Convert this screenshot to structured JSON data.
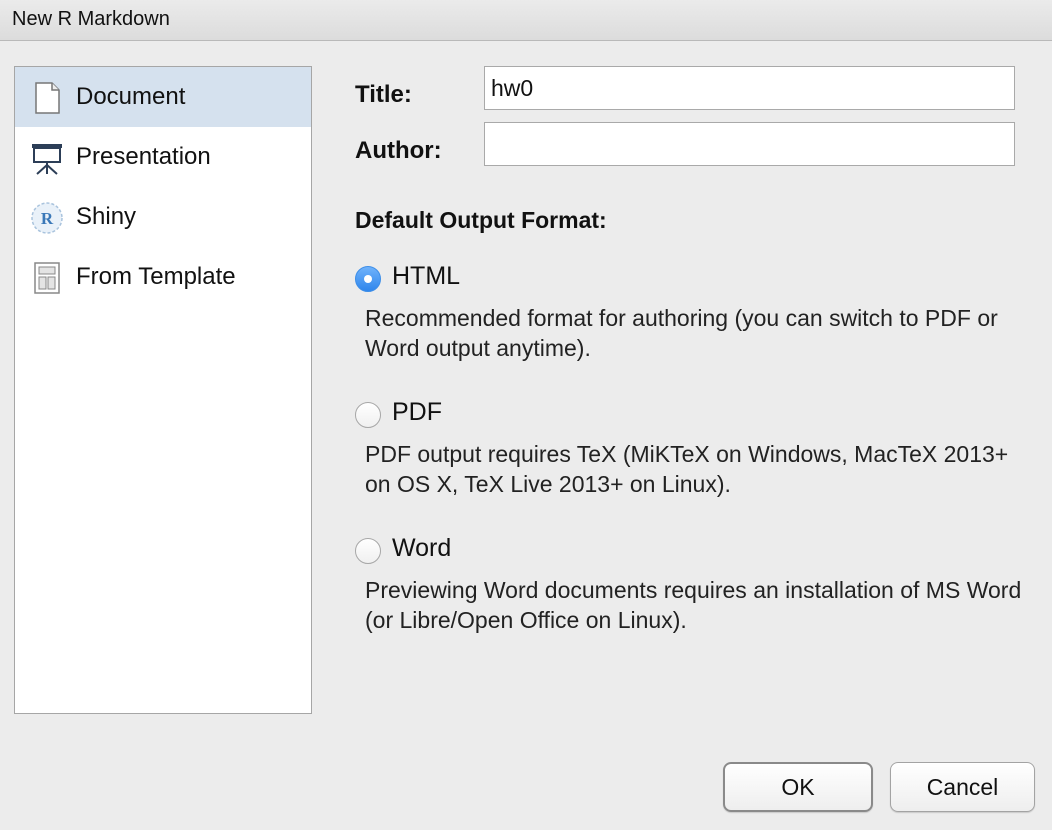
{
  "window": {
    "title": "New R Markdown"
  },
  "sidebar": {
    "items": [
      {
        "label": "Document",
        "icon": "document-icon",
        "selected": true
      },
      {
        "label": "Presentation",
        "icon": "presentation-icon",
        "selected": false
      },
      {
        "label": "Shiny",
        "icon": "shiny-icon",
        "selected": false
      },
      {
        "label": "From Template",
        "icon": "template-icon",
        "selected": false
      }
    ]
  },
  "form": {
    "title_label": "Title:",
    "title_value": "hw0",
    "author_label": "Author:",
    "author_value": ""
  },
  "output": {
    "heading": "Default Output Format:",
    "options": [
      {
        "label": "HTML",
        "checked": true,
        "description": "Recommended format for authoring (you can switch to PDF or Word output anytime)."
      },
      {
        "label": "PDF",
        "checked": false,
        "description": "PDF output requires TeX (MiKTeX on Windows, MacTeX 2013+ on OS X, TeX Live 2013+ on Linux)."
      },
      {
        "label": "Word",
        "checked": false,
        "description": "Previewing Word documents requires an installation of MS Word (or Libre/Open Office on Linux)."
      }
    ]
  },
  "buttons": {
    "ok": "OK",
    "cancel": "Cancel"
  },
  "colors": {
    "selection": "#d5e1ee",
    "radio_accent": "#2f86ec"
  }
}
